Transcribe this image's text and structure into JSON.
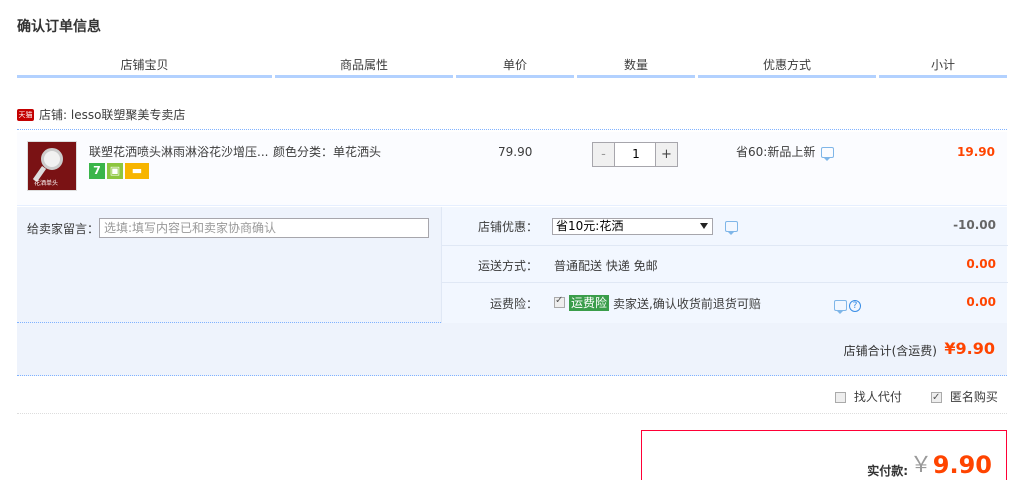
{
  "page": {
    "title": "确认订单信息"
  },
  "columns": [
    "店铺宝贝",
    "商品属性",
    "单价",
    "数量",
    "优惠方式",
    "小计"
  ],
  "shop": {
    "badge": "天猫",
    "name": "店铺: lesso联塑聚美专卖店"
  },
  "item": {
    "thumb_label": "花洒单头",
    "title": "联塑花洒喷头淋雨淋浴花沙增压...",
    "attribute": "颜色分类：单花洒头",
    "unit_price": "79.90",
    "quantity": "1",
    "minus": "-",
    "plus": "+",
    "promo": "省60:新品上新",
    "subtotal": "19.90",
    "service_icons": [
      "seven-day-return-icon",
      "shopping-bag-icon",
      "credit-card-icon"
    ],
    "seven_label": "7"
  },
  "message": {
    "label": "给卖家留言：",
    "placeholder": "选填:填写内容已和卖家协商确认"
  },
  "discount": {
    "label": "店铺优惠：",
    "selected": "省10元:花洒",
    "amount": "-10.00"
  },
  "shipping": {
    "label": "运送方式：",
    "value": "普通配送 快递 免邮",
    "amount": "0.00"
  },
  "insurance": {
    "label": "运费险：",
    "tag": "运费险",
    "text": "卖家送,确认收货前退货可赔",
    "amount": "0.00",
    "checked": true
  },
  "shop_total": {
    "label": "店铺合计(含运费)",
    "amount": "¥9.90"
  },
  "options": {
    "proxy_pay": {
      "label": "找人代付",
      "checked": false
    },
    "anonymous": {
      "label": "匿名购买",
      "checked": true
    }
  },
  "payment": {
    "label": "实付款:",
    "currency": "￥",
    "amount": "9.90"
  },
  "colors": {
    "price_red": "#ff4400",
    "header_border": "#b2d1ff",
    "insurance_green": "#3a9d4a",
    "pay_border": "#ff0036"
  }
}
